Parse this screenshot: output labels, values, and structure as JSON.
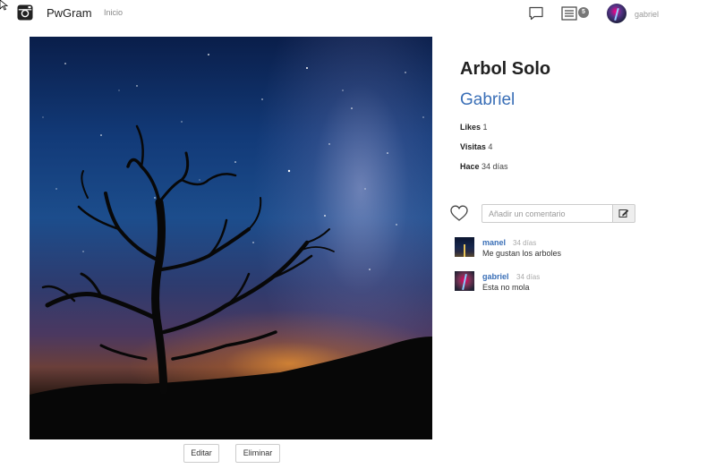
{
  "nav": {
    "brand": "PwGram",
    "home_link": "Inicio",
    "notification_count": "5",
    "username": "gabriel"
  },
  "post": {
    "title": "Arbol Solo",
    "author": "Gabriel",
    "likes_label": "Likes",
    "likes_value": "1",
    "visits_label": "Visitas",
    "visits_value": "4",
    "age_label": "Hace",
    "age_value": "34 días",
    "edit_label": "Editar",
    "delete_label": "Eliminar"
  },
  "comment_form": {
    "placeholder": "Añadir un comentario"
  },
  "comments": [
    {
      "user": "manel",
      "time": "34 días",
      "text": "Me gustan los arboles"
    },
    {
      "user": "gabriel",
      "time": "34 días",
      "text": "Esta no mola"
    }
  ],
  "icons": {
    "brand": "camera-icon",
    "chat": "chat-icon",
    "notifications": "list-icon",
    "like": "heart-icon",
    "comment_submit": "edit-icon"
  },
  "colors": {
    "link": "#3a6fb7",
    "badge": "#777777"
  }
}
